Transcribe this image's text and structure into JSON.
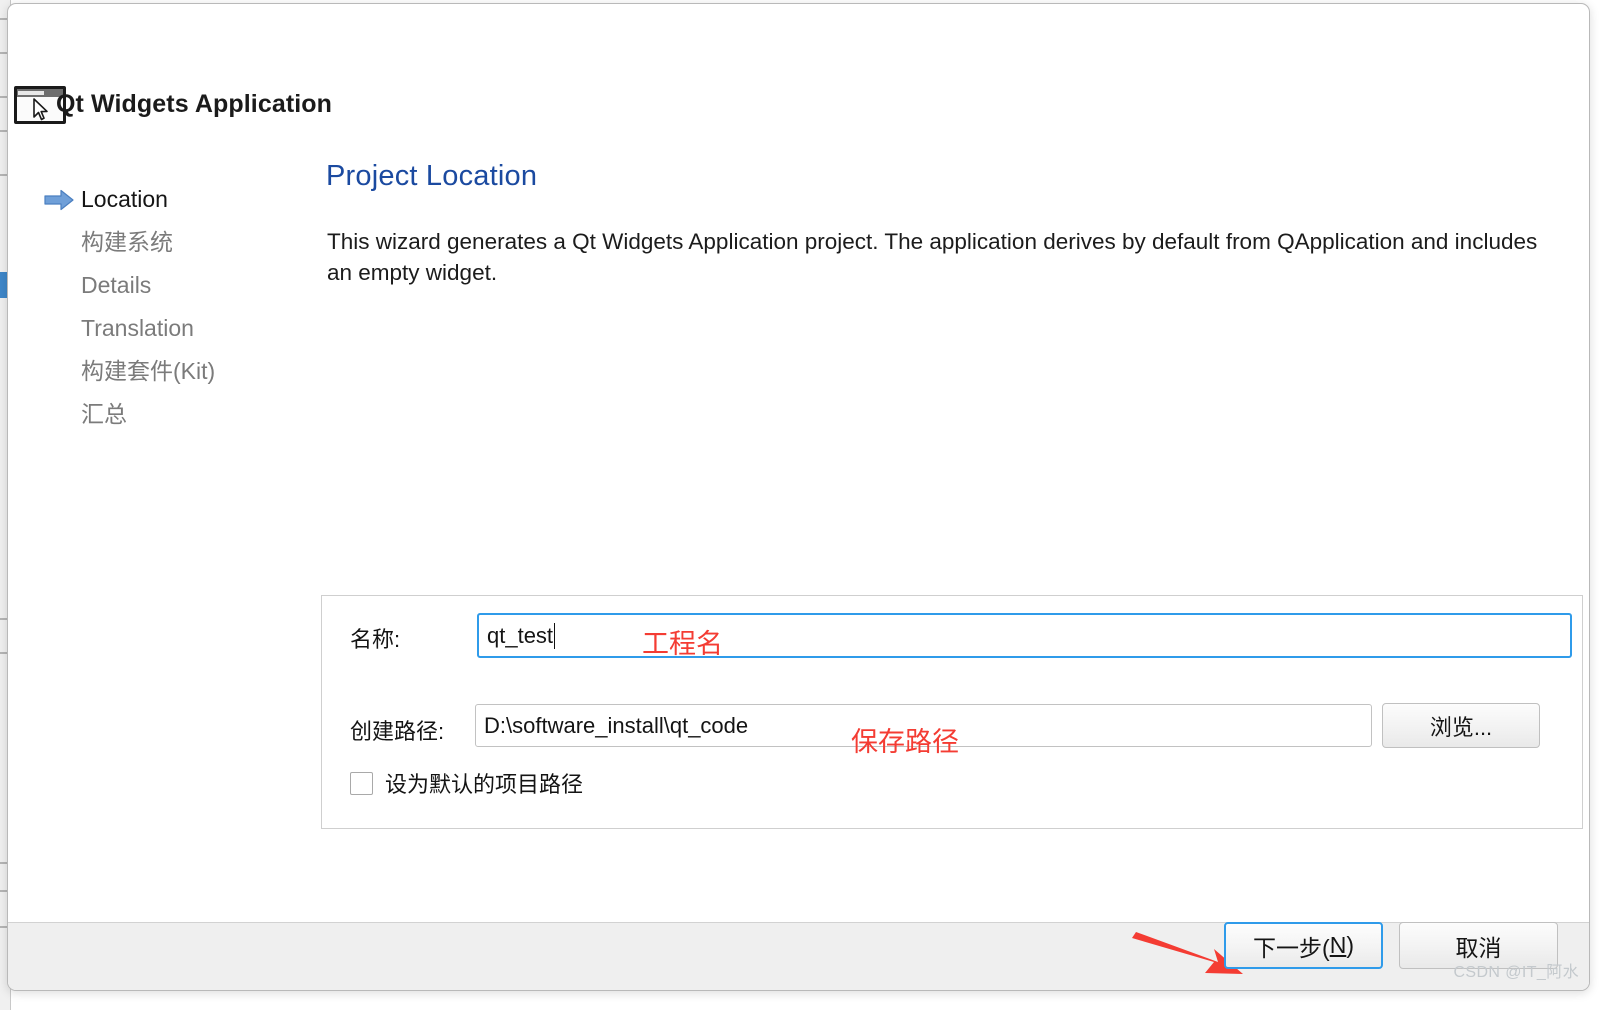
{
  "dialog": {
    "title": "Qt Widgets Application",
    "icon": "window-cursor-icon"
  },
  "nav": {
    "items": [
      {
        "label": "Location",
        "active": true,
        "icon": "blue-arrow-icon"
      },
      {
        "label": "构建系统",
        "active": false
      },
      {
        "label": "Details",
        "active": false
      },
      {
        "label": "Translation",
        "active": false
      },
      {
        "label": "构建套件(Kit)",
        "active": false
      },
      {
        "label": "汇总",
        "active": false
      }
    ]
  },
  "main": {
    "page_title": "Project Location",
    "description": "This wizard generates a Qt Widgets Application project. The application derives by default from QApplication and includes an empty widget."
  },
  "form": {
    "name_label": "名称:",
    "name_value": "qt_test",
    "name_placeholder": "",
    "path_label": "创建路径:",
    "path_value": "D:\\software_install\\qt_code",
    "path_placeholder": "",
    "browse_label": "浏览...",
    "checkbox_label": "设为默认的项目路径",
    "checkbox_checked": false
  },
  "annotations": {
    "name_note": "工程名",
    "path_note": "保存路径",
    "arrow": "red-arrow-pointing-to-next-button",
    "color": "#f43c33"
  },
  "footer": {
    "next_label_prefix": "下一步(",
    "next_mnemonic": "N",
    "next_label_suffix": ")",
    "cancel_label": "取消"
  },
  "watermark": {
    "text": "CSDN @IT_阿水"
  },
  "colors": {
    "accent_blue": "#2f9bea",
    "title_blue": "#1b4aa0",
    "annotation_red": "#f43c33",
    "footer_bg": "#efefef"
  }
}
